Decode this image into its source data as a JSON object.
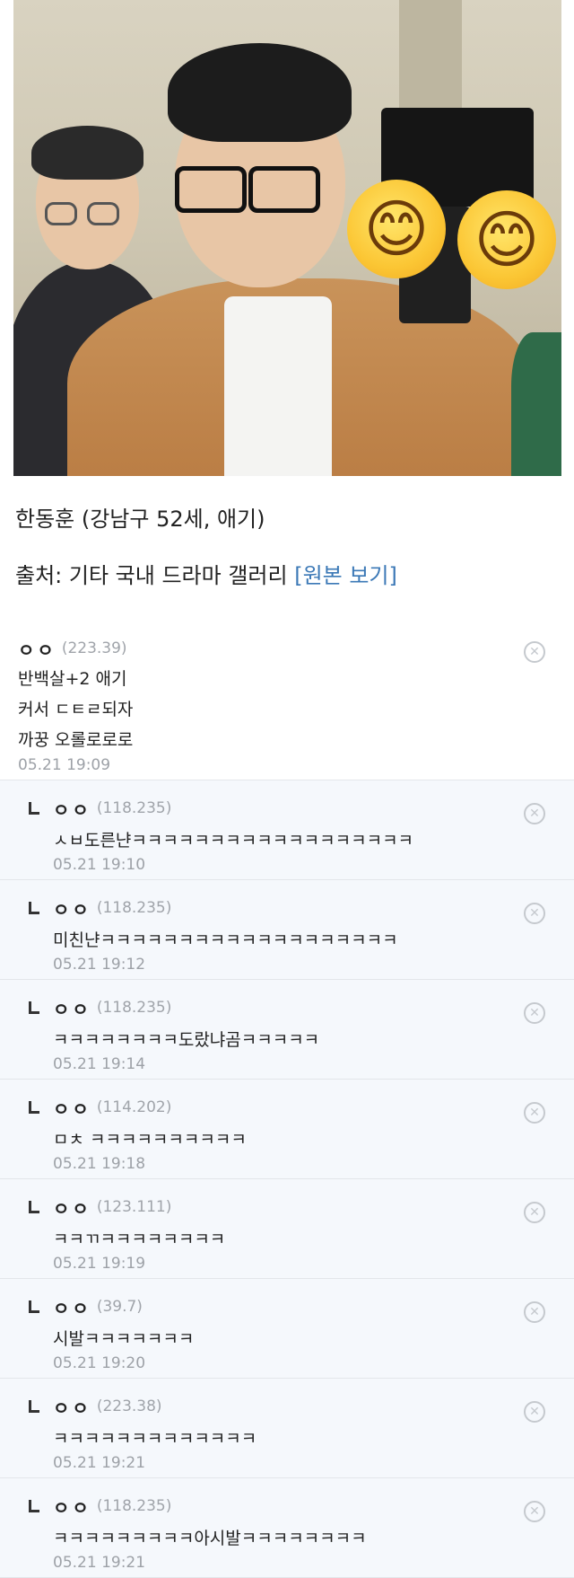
{
  "photo": {
    "emojis": [
      "😊",
      "😊"
    ]
  },
  "caption": {
    "line1": "한동훈 (강남구 52세, 애기)",
    "source_prefix": "출처: 기타 국내 드라마 갤러리 ",
    "source_link": "[원본 보기]"
  },
  "colors": {
    "link": "#3b78b6",
    "reply_bg": "#f5f8fc",
    "meta_gray": "#9da1a7"
  },
  "icons": {
    "delete": "circled-x-icon",
    "reply": "reply-corner-icon"
  },
  "comments": [
    {
      "nick": "ㅇㅇ",
      "ip": "(223.39)",
      "lines": [
        "반백살+2 애기",
        "커서 ㄷㅌㄹ되자",
        "까꿍 오롤로로로"
      ],
      "date": "05.21 19:09",
      "delete_symbol": "✕"
    },
    {
      "nick": "ㅇㅇ",
      "ip": "(118.235)",
      "text": "ㅅㅂ도른냔ㅋㅋㅋㅋㅋㅋㅋㅋㅋㅋㅋㅋㅋㅋㅋㅋㅋㅋ",
      "date": "05.21 19:10",
      "delete_symbol": "✕"
    },
    {
      "nick": "ㅇㅇ",
      "ip": "(118.235)",
      "text": "미친냔ㅋㅋㅋㅋㅋㅋㅋㅋㅋㅋㅋㅋㅋㅋㅋㅋㅋㅋㅋ",
      "date": "05.21 19:12",
      "delete_symbol": "✕"
    },
    {
      "nick": "ㅇㅇ",
      "ip": "(118.235)",
      "text": "ㅋㅋㅋㅋㅋㅋㅋㅋ도랐냐곰ㅋㅋㅋㅋㅋ",
      "date": "05.21 19:14",
      "delete_symbol": "✕"
    },
    {
      "nick": "ㅇㅇ",
      "ip": "(114.202)",
      "text": "ㅁㅊ ㅋㅋㅋㅋㅋㅋㅋㅋㅋㅋ",
      "date": "05.21 19:18",
      "delete_symbol": "✕"
    },
    {
      "nick": "ㅇㅇ",
      "ip": "(123.111)",
      "text": "ㅋㅋㄲㅋㅋㅋㅋㅋㅋㅋㅋ",
      "date": "05.21 19:19",
      "delete_symbol": "✕"
    },
    {
      "nick": "ㅇㅇ",
      "ip": "(39.7)",
      "text": "시발ㅋㅋㅋㅋㅋㅋㅋ",
      "date": "05.21 19:20",
      "delete_symbol": "✕"
    },
    {
      "nick": "ㅇㅇ",
      "ip": "(223.38)",
      "text": "ㅋㅋㅋㅋㅋㅋㅋㅋㅋㅋㅋㅋㅋ",
      "date": "05.21 19:21",
      "delete_symbol": "✕"
    },
    {
      "nick": "ㅇㅇ",
      "ip": "(118.235)",
      "text": "ㅋㅋㅋㅋㅋㅋㅋㅋㅋ아시발ㅋㅋㅋㅋㅋㅋㅋㅋ",
      "date": "05.21 19:21",
      "delete_symbol": "✕"
    }
  ]
}
